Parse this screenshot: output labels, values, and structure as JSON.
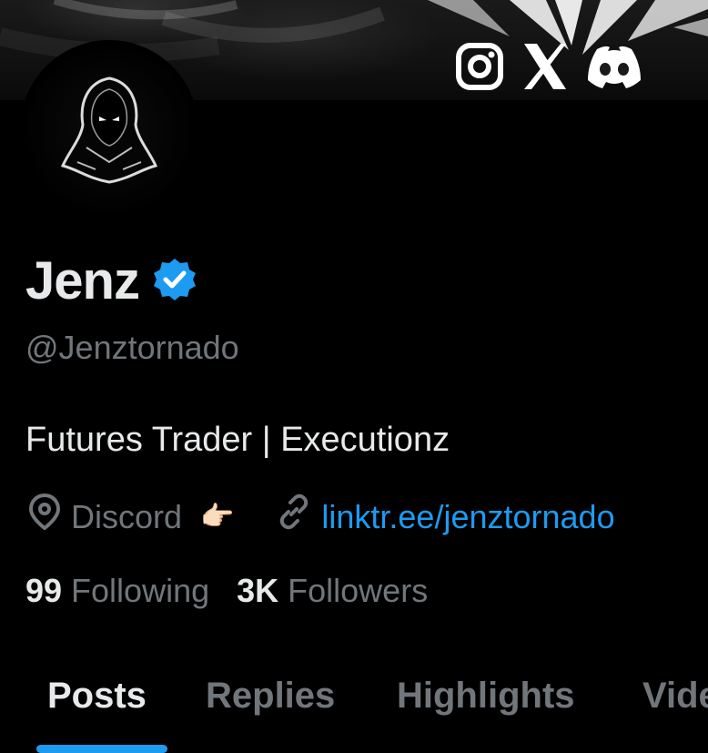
{
  "profile": {
    "display_name": "Jenz",
    "handle": "@Jenztornado",
    "bio": "Futures Trader | Executionz",
    "location": "Discord",
    "location_emoji": "👉🏻",
    "website": "linktr.ee/jenztornado",
    "verified": true
  },
  "banner": {
    "icons": [
      "instagram-icon",
      "x-logo-icon",
      "discord-icon"
    ]
  },
  "stats": {
    "following_count": "99",
    "following_label": "Following",
    "followers_count": "3K",
    "followers_label": "Followers"
  },
  "tabs": [
    {
      "label": "Posts",
      "active": true
    },
    {
      "label": "Replies",
      "active": false
    },
    {
      "label": "Highlights",
      "active": false
    },
    {
      "label": "Videos",
      "active": false
    }
  ],
  "colors": {
    "background": "#000000",
    "primary_text": "#e7e9ea",
    "secondary_text": "#71767b",
    "accent": "#1d9bf0"
  }
}
